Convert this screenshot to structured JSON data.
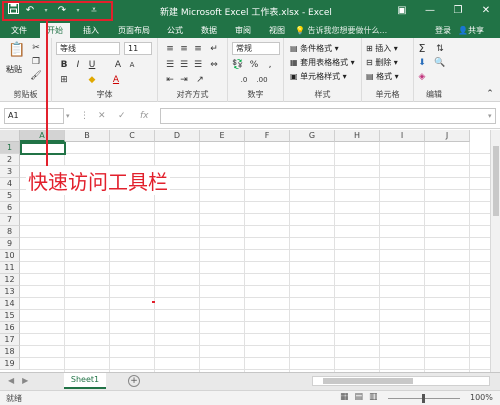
{
  "qat": {
    "save_icon": "save-icon",
    "undo_icon": "undo-icon",
    "redo_icon": "redo-icon",
    "customize_icon": "qat-customize-icon"
  },
  "window": {
    "title": "新建 Microsoft Excel 工作表.xlsx - Excel",
    "ribbon_display_icon": "ribbon-display-icon",
    "minimize": "—",
    "restore": "❐",
    "close": "✕"
  },
  "tabs": [
    {
      "label": "文件"
    },
    {
      "label": "开始",
      "active": true
    },
    {
      "label": "插入"
    },
    {
      "label": "页面布局"
    },
    {
      "label": "公式"
    },
    {
      "label": "数据"
    },
    {
      "label": "审阅"
    },
    {
      "label": "视图"
    }
  ],
  "tell_me": "告诉我您想要做什么...",
  "login": "登录",
  "share": "共享",
  "ribbon": {
    "clipboard": {
      "label": "剪贴板",
      "paste": "粘贴"
    },
    "font": {
      "label": "字体",
      "font_name": "等线",
      "font_size": "11",
      "bold": "B",
      "italic": "I",
      "underline": "U"
    },
    "alignment": {
      "label": "对齐方式"
    },
    "number": {
      "label": "数字",
      "format": "常规",
      "percent": "%"
    },
    "styles": {
      "label": "样式",
      "conditional": "条件格式",
      "table": "套用表格格式",
      "cell_styles": "单元格样式"
    },
    "cells": {
      "label": "单元格",
      "insert": "插入",
      "delete": "删除",
      "format": "格式"
    },
    "editing": {
      "label": "编辑"
    }
  },
  "formula_bar": {
    "name_box": "A1",
    "cancel": "✕",
    "enter": "✓",
    "fx": "fx",
    "value": ""
  },
  "columns": [
    "A",
    "B",
    "C",
    "D",
    "E",
    "F",
    "G",
    "H",
    "I",
    "J"
  ],
  "rows": [
    "1",
    "2",
    "3",
    "4",
    "5",
    "6",
    "7",
    "8",
    "9",
    "10",
    "11",
    "12",
    "13",
    "14",
    "15",
    "16",
    "17",
    "18",
    "19"
  ],
  "sheets": [
    {
      "name": "Sheet1",
      "active": true
    }
  ],
  "status": {
    "ready": "就绪",
    "zoom": "100%",
    "zoom_level": 1.0
  },
  "annotation": {
    "label": "快速访问工具栏"
  },
  "colors": {
    "excel_green": "#217346",
    "annotation_red": "#e2202c"
  }
}
